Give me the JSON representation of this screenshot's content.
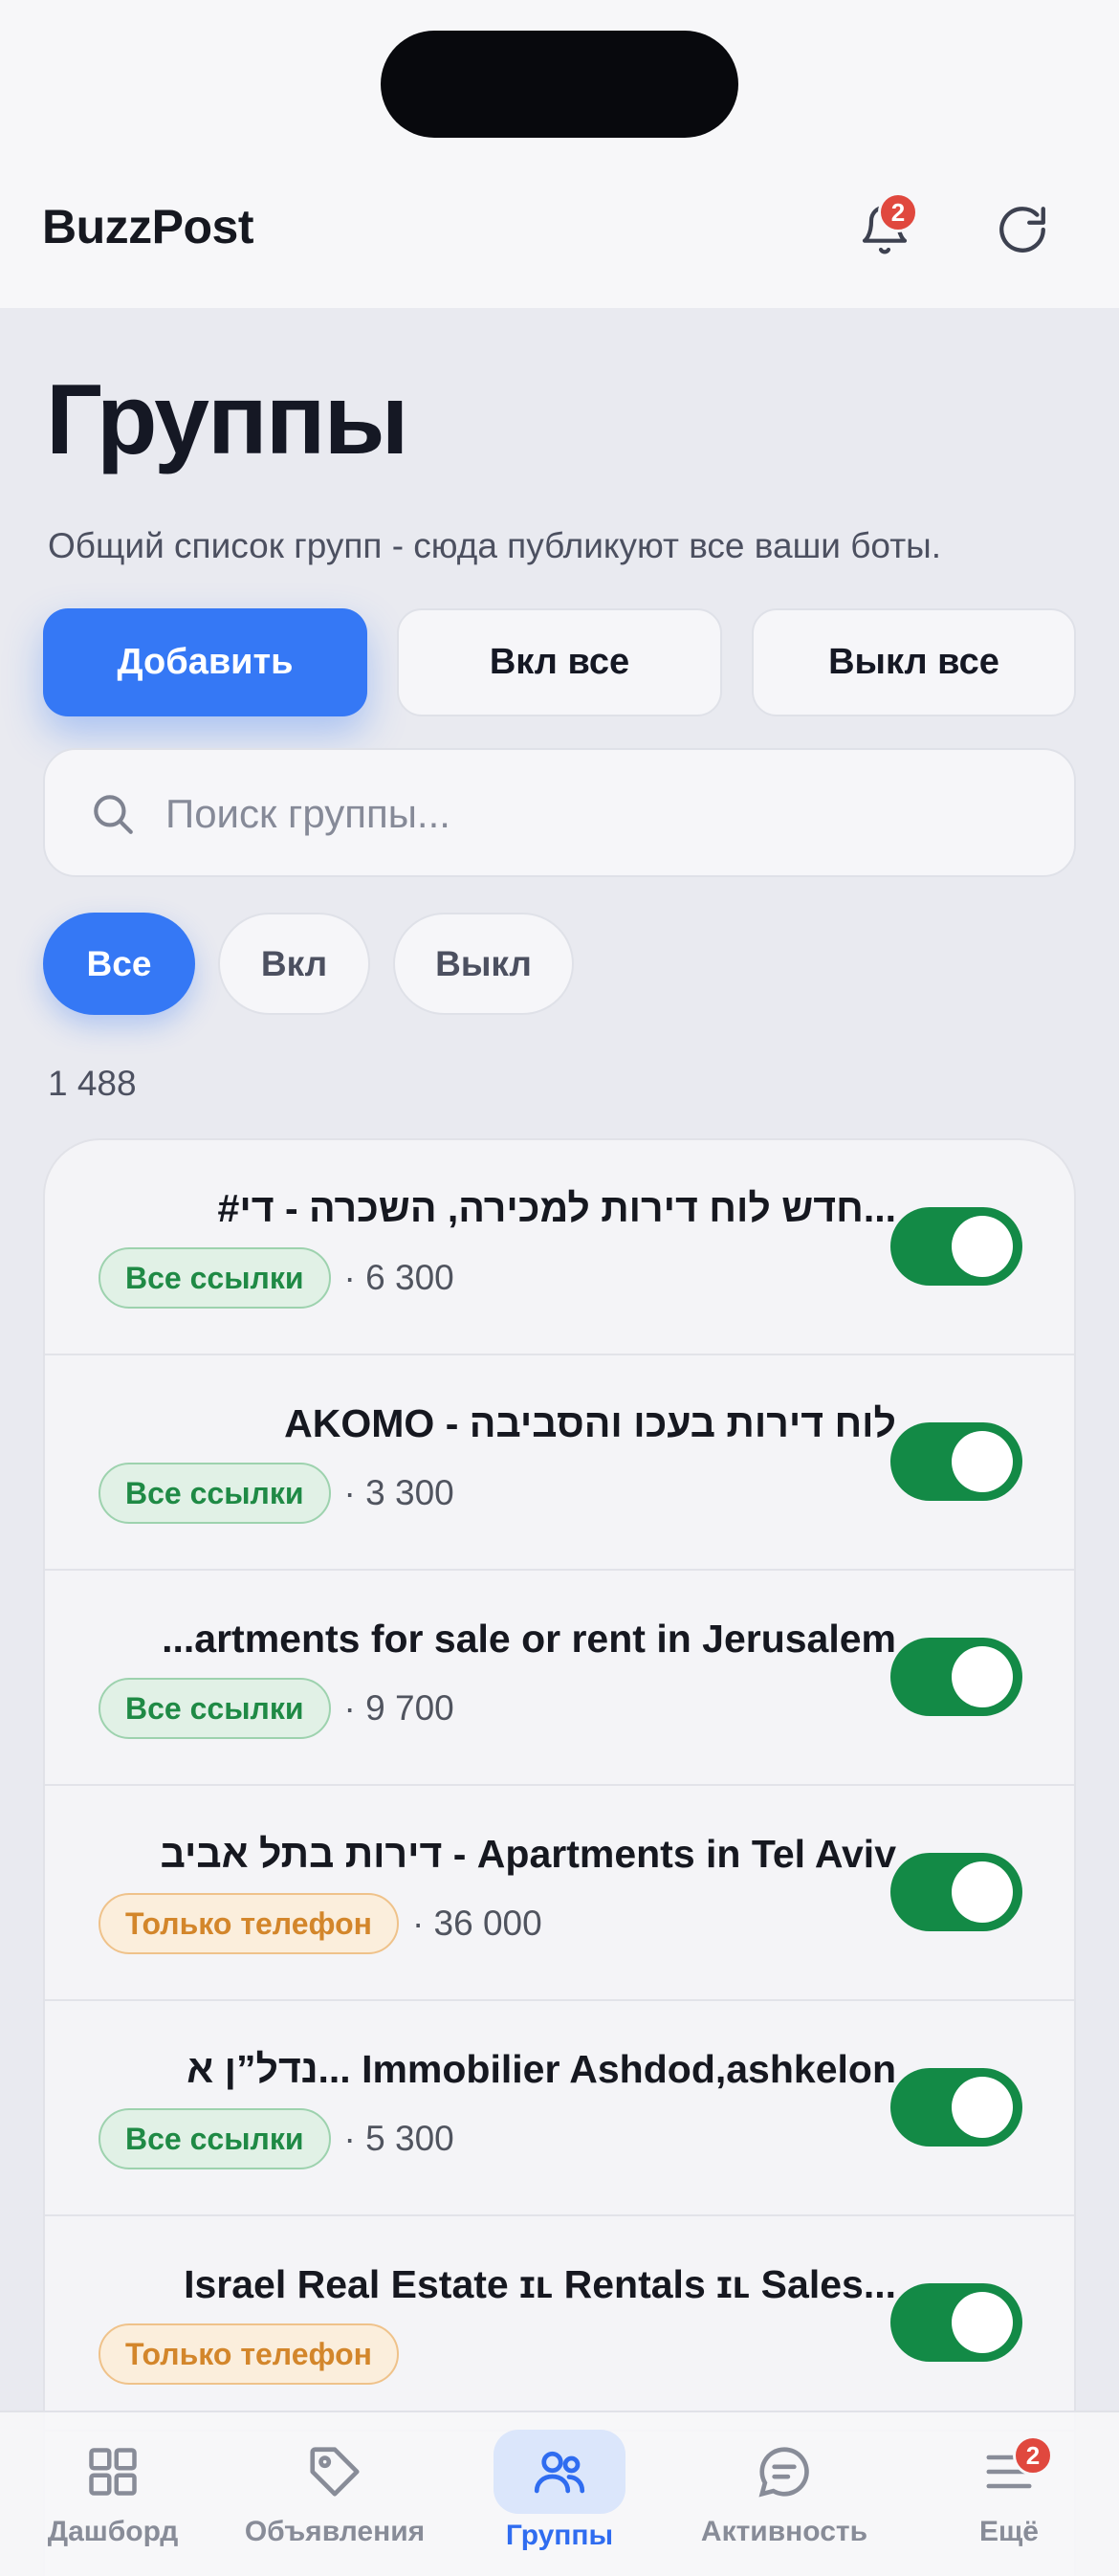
{
  "header": {
    "app_title": "BuzzPost",
    "notification_count": "2"
  },
  "page": {
    "title": "Группы",
    "subtitle": "Общий список групп - сюда публикуют все ваши боты."
  },
  "actions": {
    "add_label": "Добавить",
    "enable_all_label": "Вкл все",
    "disable_all_label": "Выкл все"
  },
  "search": {
    "placeholder": "Поиск группы..."
  },
  "filters": {
    "all": "Все",
    "on": "Вкл",
    "off": "Выкл",
    "selected": "Все"
  },
  "count": "1 488",
  "groups": [
    {
      "title": "#חדש לוח דירות למכירה, השכרה - די...",
      "tag": "Все ссылки",
      "tag_color": "green",
      "members": "· 6 300",
      "enabled": true
    },
    {
      "title": "AKOMO - לוח דירות בעכו והסביבה",
      "tag": "Все ссылки",
      "tag_color": "green",
      "members": "· 3 300",
      "enabled": true
    },
    {
      "title": "...artments for sale or rent in Jerusalem",
      "tag": "Все ссылки",
      "tag_color": "green",
      "members": "· 9 700",
      "enabled": true
    },
    {
      "title": "דירות בתל אביב - Apartments in Tel Aviv",
      "tag": "Только телефон",
      "tag_color": "orange",
      "members": "· 36 000",
      "enabled": true
    },
    {
      "title": "נדל”ן א... Immobilier Ashdod,ashkelon",
      "tag": "Все ссылки",
      "tag_color": "green",
      "members": "· 5 300",
      "enabled": true
    },
    {
      "title": "Israel Real Estate ɪʟ Rentals ɪʟ Sales...",
      "tag": "Только телефон",
      "tag_color": "orange",
      "members": "",
      "enabled": true
    }
  ],
  "bottom_nav": {
    "items": [
      {
        "label": "Дашборд",
        "icon": "grid-icon"
      },
      {
        "label": "Объявления",
        "icon": "tag-icon"
      },
      {
        "label": "Группы",
        "icon": "users-icon"
      },
      {
        "label": "Активность",
        "icon": "chat-icon"
      },
      {
        "label": "Ещё",
        "icon": "menu-icon"
      }
    ],
    "active": "Группы",
    "more_badge": "2"
  },
  "colors": {
    "accent": "#3578f5",
    "toggle_on": "#138a46",
    "badge": "#e0483e",
    "tag_green": "#1f8a45",
    "tag_orange": "#d3862b"
  }
}
